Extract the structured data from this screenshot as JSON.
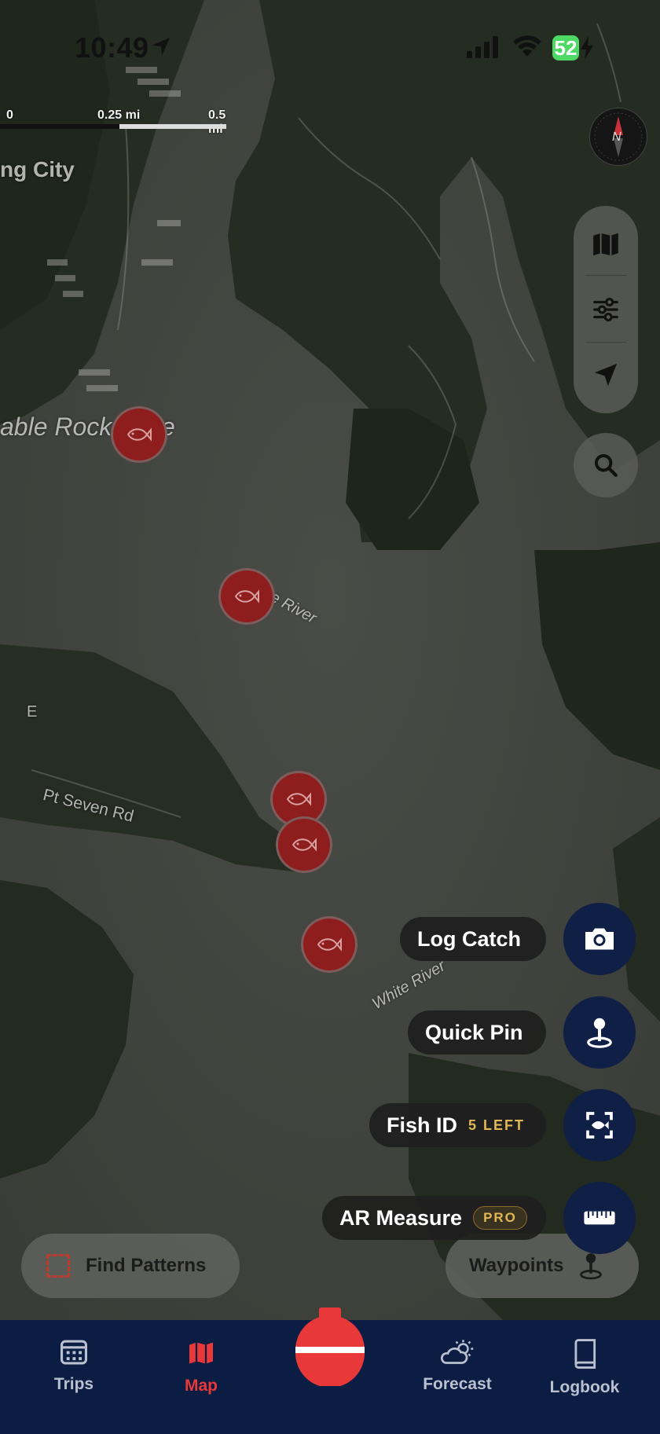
{
  "status_bar": {
    "time": "10:49",
    "battery": "52"
  },
  "map": {
    "scale": {
      "labels": [
        "0",
        "0.25 mi",
        "0.5 mi"
      ]
    },
    "labels": {
      "city": "ng City",
      "lake": "able Rock",
      "lake_tail": "e",
      "river_upper": "White River",
      "river_lower": "White River",
      "road": "Pt Seven Rd",
      "road_marker": "E"
    },
    "compass_letter": "N",
    "catch_markers": [
      "fish-icon",
      "fish-icon",
      "fish-icon",
      "fish-icon",
      "fish-icon"
    ]
  },
  "map_tools": {
    "layers_icon": "map-layers-icon",
    "filters_icon": "sliders-icon",
    "locate_icon": "location-arrow-icon",
    "search_icon": "search-icon"
  },
  "actions": {
    "log_catch": "Log Catch",
    "quick_pin": "Quick Pin",
    "fish_id": "Fish ID",
    "fish_id_badge": "5 LEFT",
    "ar_measure": "AR Measure",
    "ar_measure_badge": "PRO"
  },
  "bottom_pills": {
    "find_patterns": "Find Patterns",
    "waypoints": "Waypoints"
  },
  "tabs": {
    "trips": "Trips",
    "map": "Map",
    "forecast": "Forecast",
    "logbook": "Logbook"
  },
  "colors": {
    "accent_red": "#e8383a",
    "navy": "#0c1d43",
    "badge_gold": "#e3b656",
    "battery_green": "#4cd964"
  }
}
